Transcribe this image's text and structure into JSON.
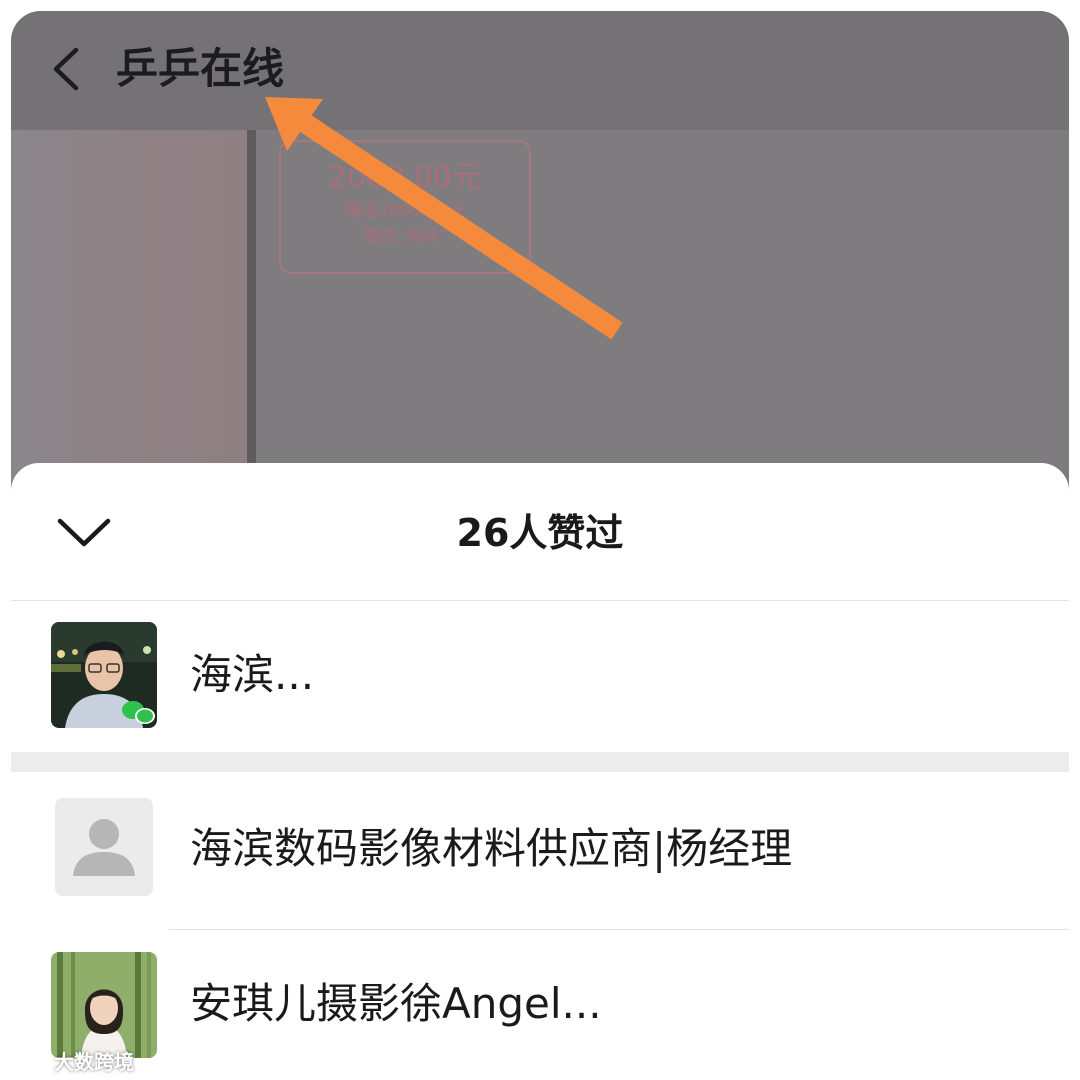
{
  "header": {
    "title": "乒乒在线",
    "back_icon": "chevron-left-icon"
  },
  "background_card": {
    "amount": "2000.00元",
    "line1": "赠送2000.00元",
    "line2": "赠送“海兵”"
  },
  "annotation": {
    "color": "#f58a3c",
    "icon": "arrow-icon"
  },
  "sheet": {
    "title": "26人赞过",
    "collapse_icon": "chevron-down-icon",
    "likers": [
      {
        "name": "海滨...",
        "avatar": "photo-avatar-man"
      },
      {
        "name": "海滨数码影像材料供应商|杨经理",
        "avatar": "default-avatar"
      },
      {
        "name": "安琪儿摄影徐Angel...",
        "avatar": "photo-avatar-woman"
      }
    ]
  },
  "watermark": {
    "text": "大数跨境"
  },
  "colors": {
    "dim_overlay": "#7f7c80",
    "sheet_bg": "#ffffff",
    "accent_arrow": "#f58a3c",
    "divider": "#e4e4e4"
  }
}
